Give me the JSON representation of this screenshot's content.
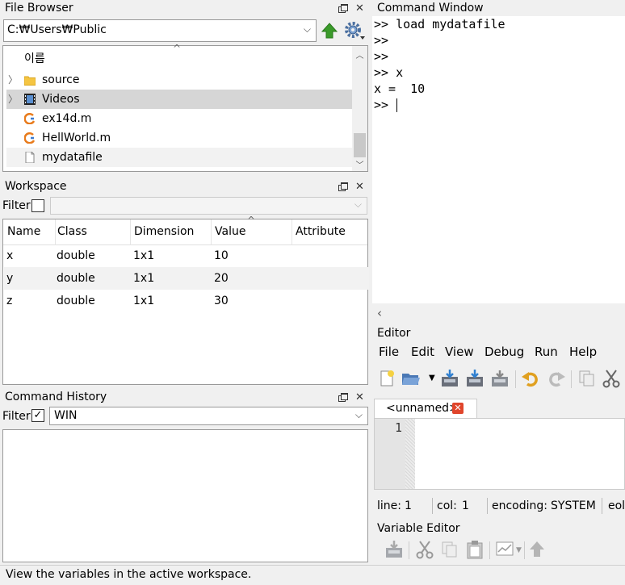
{
  "file_browser": {
    "title": "File Browser",
    "path": "C:₩Users₩Public",
    "column_header": "이름",
    "items": [
      {
        "label": "source",
        "type": "folder"
      },
      {
        "label": "Videos",
        "type": "video-folder"
      },
      {
        "label": "ex14d.m",
        "type": "m-file"
      },
      {
        "label": "HellWorld.m",
        "type": "m-file"
      },
      {
        "label": "mydatafile",
        "type": "file"
      }
    ]
  },
  "workspace": {
    "title": "Workspace",
    "filter_label": "Filter",
    "columns": [
      "Name",
      "Class",
      "Dimension",
      "Value",
      "Attribute"
    ],
    "rows": [
      {
        "name": "x",
        "class": "double",
        "dimension": "1x1",
        "value": "10",
        "attribute": ""
      },
      {
        "name": "y",
        "class": "double",
        "dimension": "1x1",
        "value": "20",
        "attribute": ""
      },
      {
        "name": "z",
        "class": "double",
        "dimension": "1x1",
        "value": "30",
        "attribute": ""
      }
    ]
  },
  "history": {
    "title": "Command History",
    "filter_label": "Filter",
    "filter_value": "WIN"
  },
  "command_window": {
    "title": "Command Window",
    "lines": [
      ">> load mydatafile",
      ">>",
      ">>",
      ">> x",
      "x =  10",
      ">> "
    ]
  },
  "editor": {
    "title": "Editor",
    "menu": [
      "File",
      "Edit",
      "View",
      "Debug",
      "Run",
      "Help"
    ],
    "tab_label": "<unnamed>",
    "line_number": "1",
    "status": {
      "line_label": "line:",
      "line_value": "1",
      "col_label": "col:",
      "col_value": "1",
      "encoding_label": "encoding:",
      "encoding_value": "SYSTEM",
      "eol_label": "eol"
    }
  },
  "variable_editor": {
    "title": "Variable Editor"
  },
  "statusbar": {
    "text": "View the variables in the active workspace."
  },
  "colors": {
    "selected_row": "#d6d6d6",
    "alt_row": "#f2f2f2",
    "up_arrow": "#3a9a2a",
    "close_tab": "#e0452b",
    "m_file_blue": "#3b7bd0",
    "m_file_orange": "#e87b1c"
  }
}
